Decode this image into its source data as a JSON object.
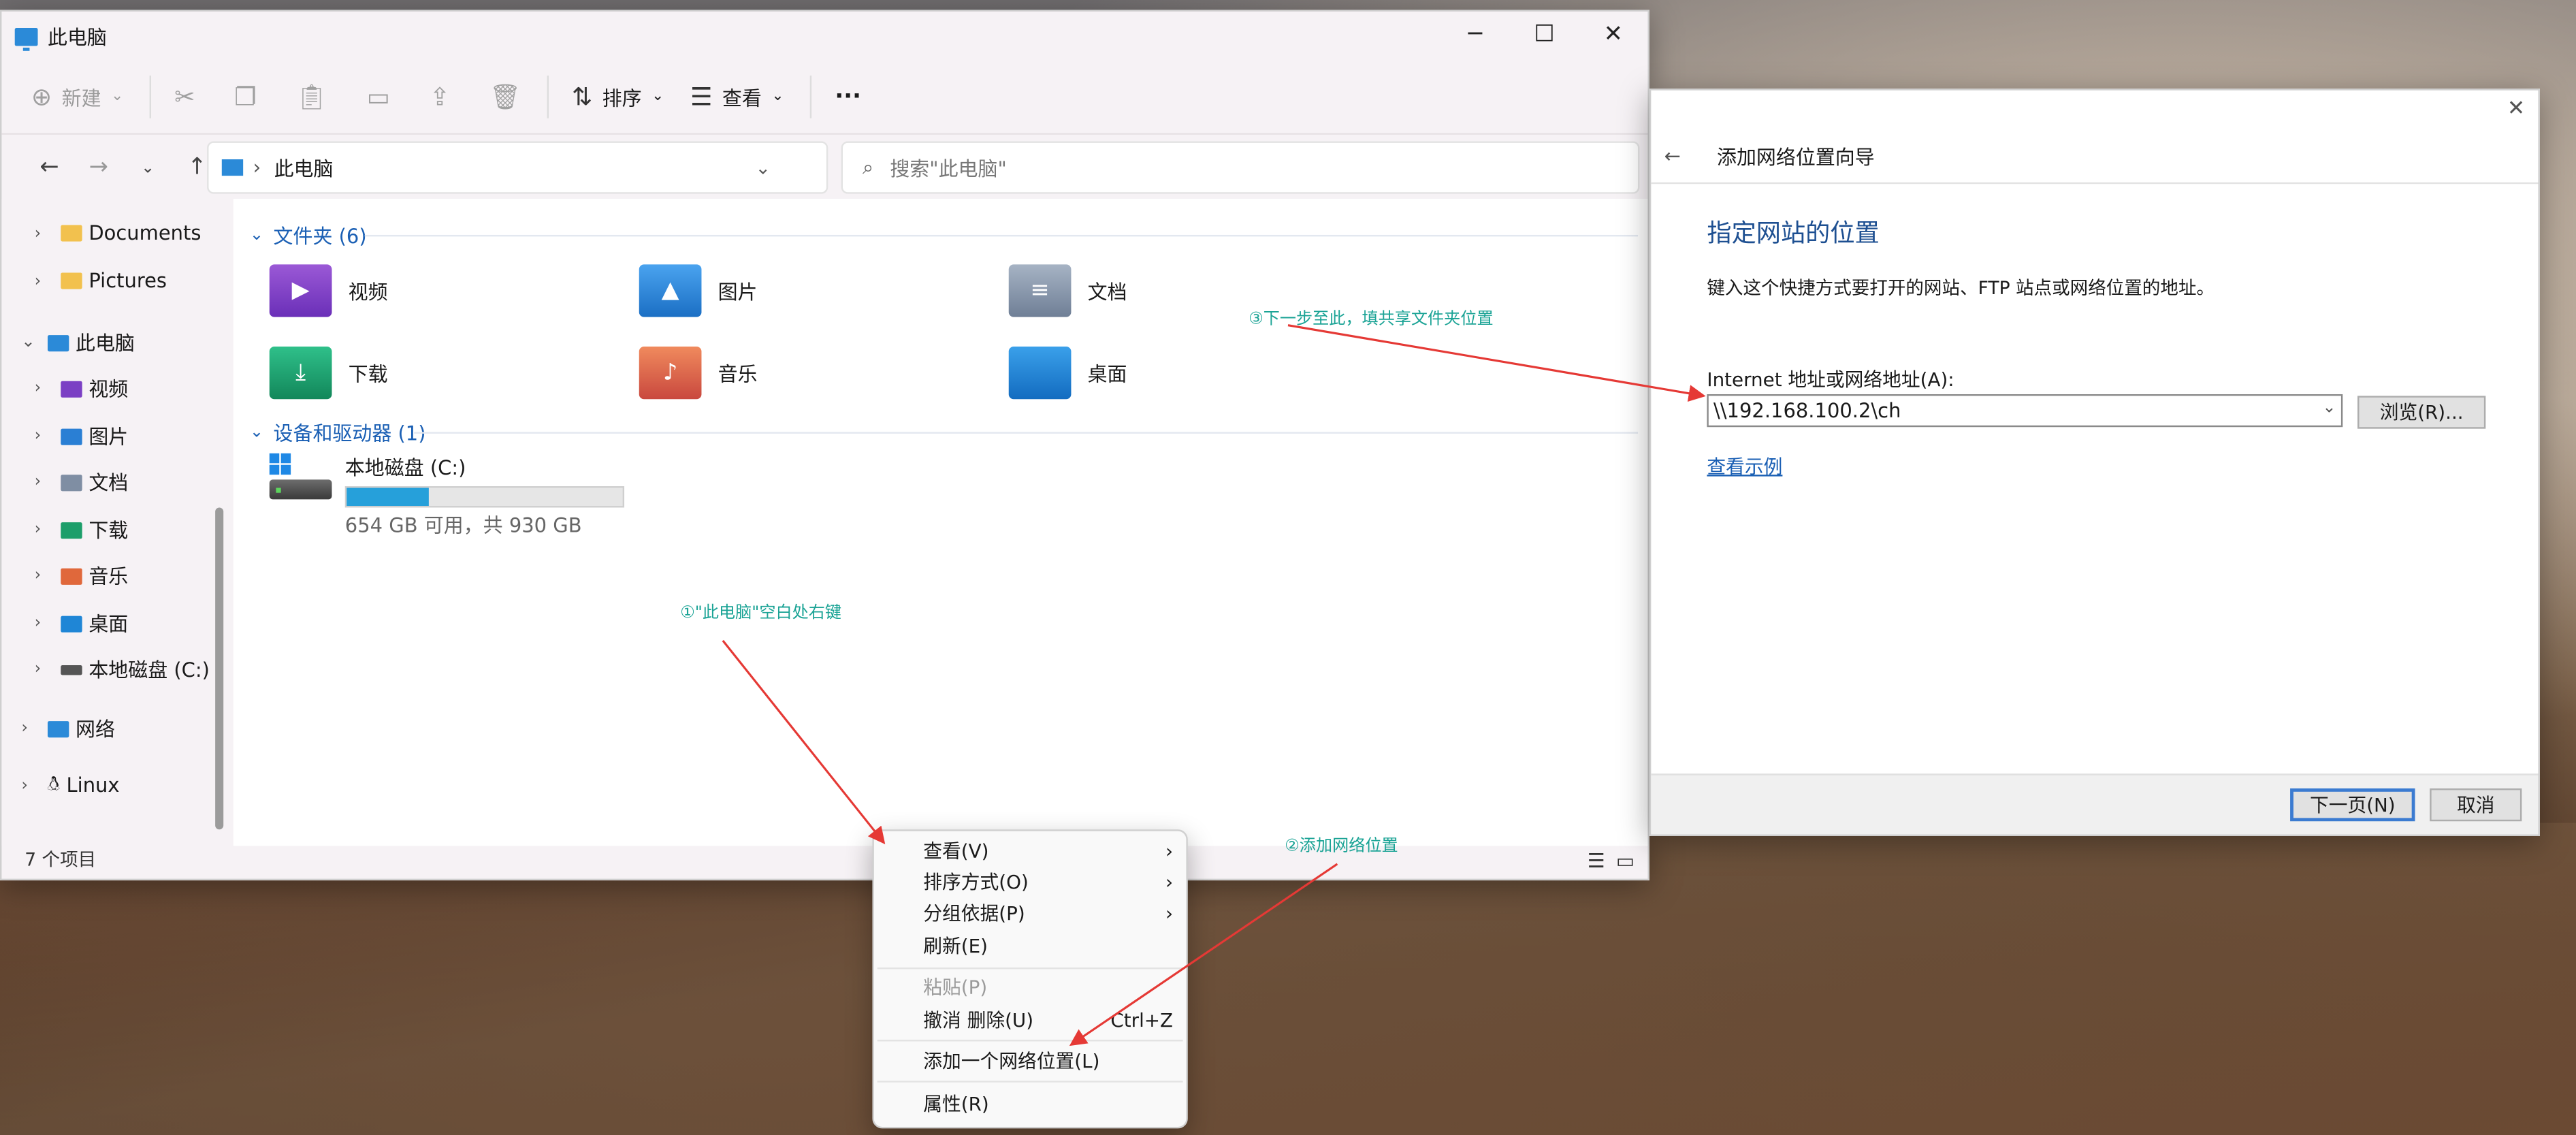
{
  "explorer": {
    "title": "此电脑",
    "toolbar": {
      "new_label": "新建",
      "sort_label": "排序",
      "view_label": "查看",
      "more_label": "···"
    },
    "address": {
      "breadcrumb": "此电脑"
    },
    "search": {
      "placeholder": "搜索\"此电脑\""
    },
    "sidebar": {
      "items": [
        {
          "label": "Documents"
        },
        {
          "label": "Pictures"
        },
        {
          "label": "此电脑"
        },
        {
          "label": "视频"
        },
        {
          "label": "图片"
        },
        {
          "label": "文档"
        },
        {
          "label": "下载"
        },
        {
          "label": "音乐"
        },
        {
          "label": "桌面"
        },
        {
          "label": "本地磁盘 (C:)"
        },
        {
          "label": "网络"
        },
        {
          "label": "Linux"
        }
      ]
    },
    "folders_section": {
      "title": "文件夹 (6)"
    },
    "folders": [
      {
        "label": "视频"
      },
      {
        "label": "图片"
      },
      {
        "label": "文档"
      },
      {
        "label": "下载"
      },
      {
        "label": "音乐"
      },
      {
        "label": "桌面"
      }
    ],
    "drives_section": {
      "title": "设备和驱动器 (1)"
    },
    "drive": {
      "label": "本地磁盘 (C:)",
      "space_text": "654 GB 可用，共 930 GB",
      "used_fraction": 0.297
    },
    "status": "7 个项目"
  },
  "context_menu": {
    "items": [
      {
        "label": "查看(V)",
        "shortcut": ""
      },
      {
        "label": "排序方式(O)",
        "shortcut": ""
      },
      {
        "label": "分组依据(P)",
        "shortcut": ""
      },
      {
        "label": "刷新(E)",
        "shortcut": ""
      },
      {
        "label": "粘贴(P)",
        "shortcut": ""
      },
      {
        "label": "撤消 删除(U)",
        "shortcut": "Ctrl+Z"
      },
      {
        "label": "添加一个网络位置(L)",
        "shortcut": ""
      },
      {
        "label": "属性(R)",
        "shortcut": ""
      }
    ]
  },
  "wizard": {
    "title": "添加网络位置向导",
    "heading": "指定网站的位置",
    "description": "键入这个快捷方式要打开的网站、FTP 站点或网络位置的地址。",
    "field_label": "Internet 地址或网络地址(A):",
    "field_value": "\\\\192.168.100.2\\ch",
    "browse_label": "浏览(R)...",
    "example_link": "查看示例",
    "next_label": "下一页(N)",
    "cancel_label": "取消"
  },
  "annotations": {
    "step1": "①\"此电脑\"空白处右键",
    "step2": "②添加网络位置",
    "step3": "③下一步至此，填共享文件夹位置"
  },
  "colors": {
    "accent": "#1a5fb4",
    "annotation_text": "#1aa395",
    "arrow": "#e53935",
    "drive_fill": "#26a0da"
  }
}
